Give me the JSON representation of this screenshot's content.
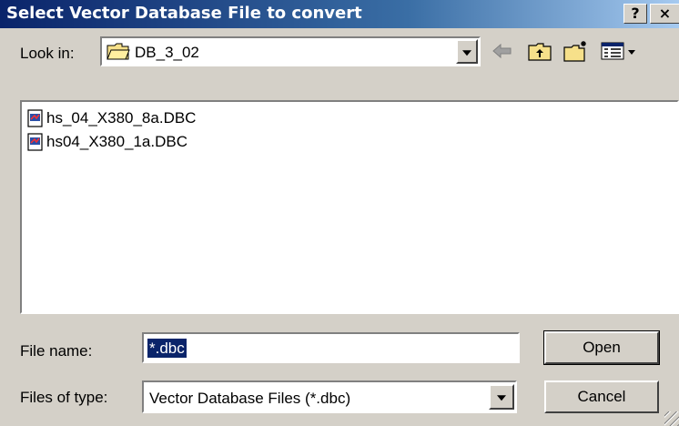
{
  "window": {
    "title": "Select Vector Database File to convert",
    "help_label": "?",
    "close_label": "×"
  },
  "look_in": {
    "label": "Look in:",
    "value": "DB_3_02"
  },
  "toolbar": {
    "icons": [
      "back-arrow-icon",
      "up-one-level-icon",
      "create-new-folder-icon",
      "view-menu-icon"
    ]
  },
  "files": [
    {
      "name": "hs_04_X380_8a.DBC",
      "icon": "dbc-file-icon"
    },
    {
      "name": "hs04_X380_1a.DBC",
      "icon": "dbc-file-icon"
    }
  ],
  "file_name": {
    "label": "File name:",
    "value": "*.dbc"
  },
  "file_type": {
    "label": "Files of type:",
    "value": "Vector Database Files (*.dbc)"
  },
  "buttons": {
    "open": "Open",
    "cancel": "Cancel"
  },
  "colors": {
    "titlebar_start": "#0a246a",
    "titlebar_end": "#a6caf0",
    "face": "#d4d0c8",
    "selection": "#0a246a"
  }
}
